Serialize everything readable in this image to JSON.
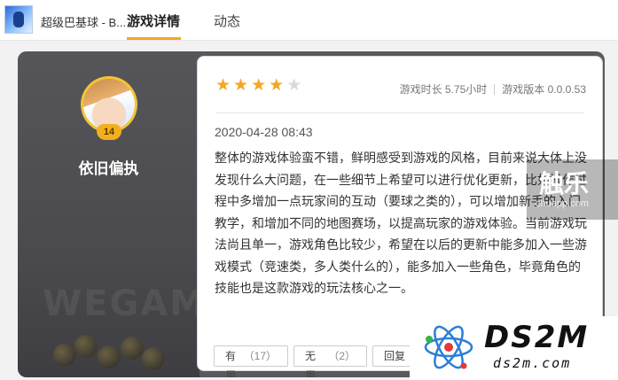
{
  "nav": {
    "game_title": "超级巴基球 - B...",
    "tabs": [
      {
        "label": "游戏详情",
        "active": true
      },
      {
        "label": "动态",
        "active": false
      }
    ],
    "accent_color": "#f5a623"
  },
  "reviewer": {
    "name": "依旧偏执",
    "level": "14",
    "watermark": "WEGAME"
  },
  "review": {
    "rating": 4,
    "rating_max": 5,
    "playtime": "游戏时长 5.75小时",
    "version": "游戏版本 0.0.0.53",
    "date": "2020-04-28 08:43",
    "text": "整体的游戏体验蛮不错，鲜明感受到游戏的风格，目前来说大体上没发现什么大问题，在一些细节上希望可以进行优化更新，比如操作过程中多增加一点玩家间的互动（要球之类的），可以增加新手的入门教学，和增加不同的地图赛场，以提高玩家的游戏体验。当前游戏玩法尚且单一，游戏角色比较少，希望在以后的更新中能多加入一些游戏模式（竞速类，多人类什么的），能多加入一些角色，毕竟角色的技能也是这款游戏的玩法核心之一。",
    "actions": {
      "useful_label": "有用",
      "useful_count": "（17）",
      "useless_label": "无用",
      "useless_count": "（2）",
      "reply_label": "回复"
    }
  },
  "watermarks": {
    "chuapp_logo": "触乐",
    "chuapp_url": "chuapp.com",
    "ds2m_brand": "DS2M",
    "ds2m_site": "ds2m.com"
  }
}
